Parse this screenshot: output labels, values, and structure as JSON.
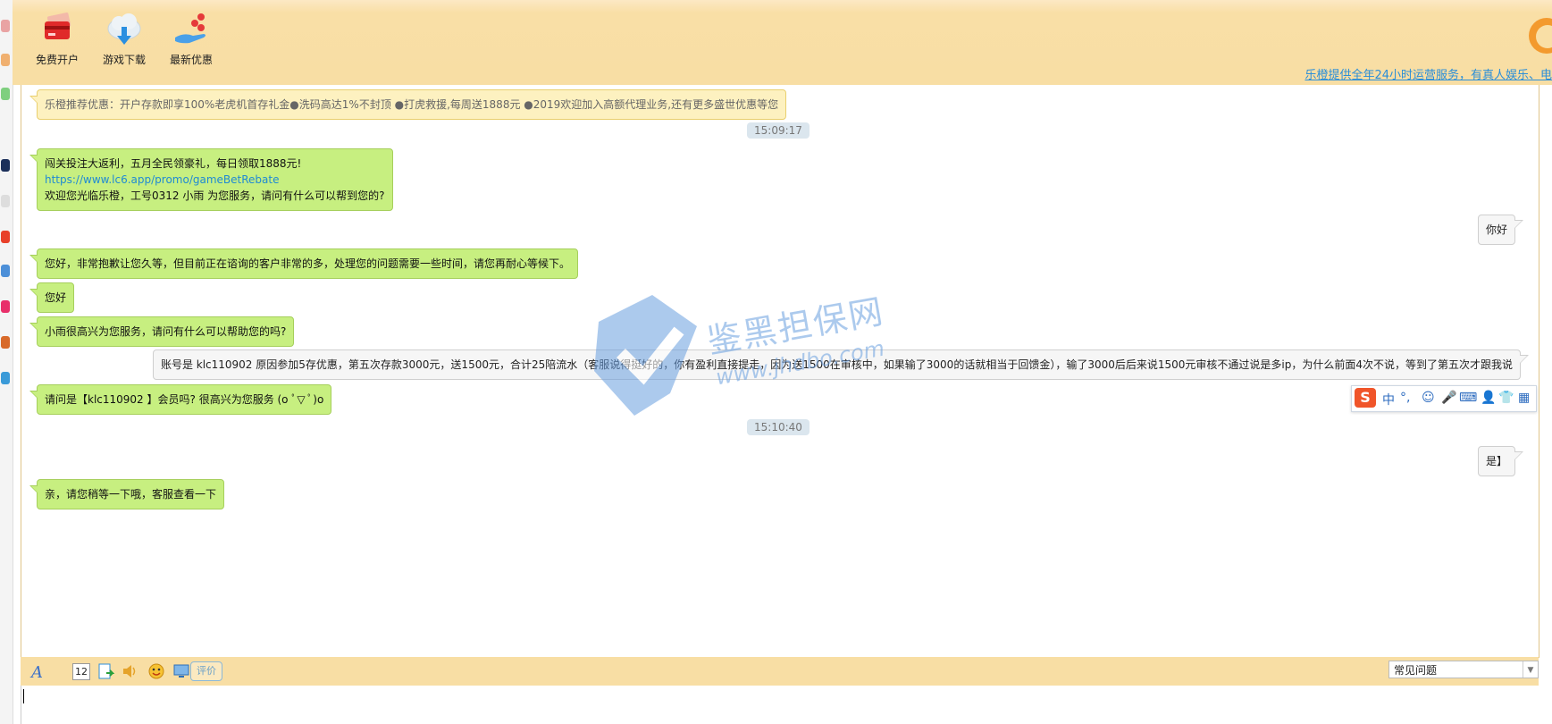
{
  "nav": {
    "items": [
      {
        "label": "免费开户",
        "icon": "card-icon"
      },
      {
        "label": "游戏下载",
        "icon": "cloud-download-icon"
      },
      {
        "label": "最新优惠",
        "icon": "gift-hand-icon"
      }
    ]
  },
  "header": {
    "service_text": "乐橙提供全年24小时运营服务，有真人娱乐、电"
  },
  "chat": {
    "promo": "乐橙推荐优惠：开户存款即享100%老虎机首存礼金●洗码高达1%不封顶 ●打虎救援,每周送1888元 ●2019欢迎加入高额代理业务,还有更多盛世优惠等您",
    "time1": "15:09:17",
    "msg1_line1": "闯关投注大返利，五月全民领豪礼，每日领取1888元!",
    "msg1_link": "https://www.lc6.app/promo/gameBetRebate",
    "msg1_line3": "欢迎您光临乐橙，工号0312 小雨 为您服务，请问有什么可以帮到您的?",
    "user1": "你好",
    "msg2": "您好，非常抱歉让您久等，但目前正在谘询的客户非常的多，处理您的问题需要一些时间，请您再耐心等候下。",
    "msg3": "您好",
    "msg4": "小雨很高兴为您服务，请问有什么可以帮助您的吗?",
    "user2": "账号是 klc110902 原因参加5存优惠，第五次存款3000元，送1500元，合计25陪流水（客服说得挺好的，你有盈利直接提走，因为送1500在审核中，如果输了3000的话就相当于回馈金），输了3000后后来说1500元审核不通过说是多ip，为什么前面4次不说，等到了第五次才跟我说",
    "msg5": "请问是【klc110902 】会员吗? 很高兴为您服务 (o ﾟ▽ ﾟ)o",
    "time2": "15:10:40",
    "user3": "是】",
    "msg6": "亲，请您稍等一下哦，客服查看一下"
  },
  "watermark": {
    "text": "鉴黑担保网",
    "url": "www.jhdbo.com"
  },
  "ime": {
    "logo": "S",
    "mode": "中",
    "punct": "°,"
  },
  "toolbar": {
    "font_size": "12",
    "rate_label": "评价",
    "faq_selected": "常见问题"
  },
  "colors": {
    "header_bg": "#f8dea4",
    "agent_bubble": "#c7ef80",
    "promo_bubble": "#fdf1c0",
    "user_bubble": "#f6f6f6",
    "link": "#1f8ad4"
  }
}
